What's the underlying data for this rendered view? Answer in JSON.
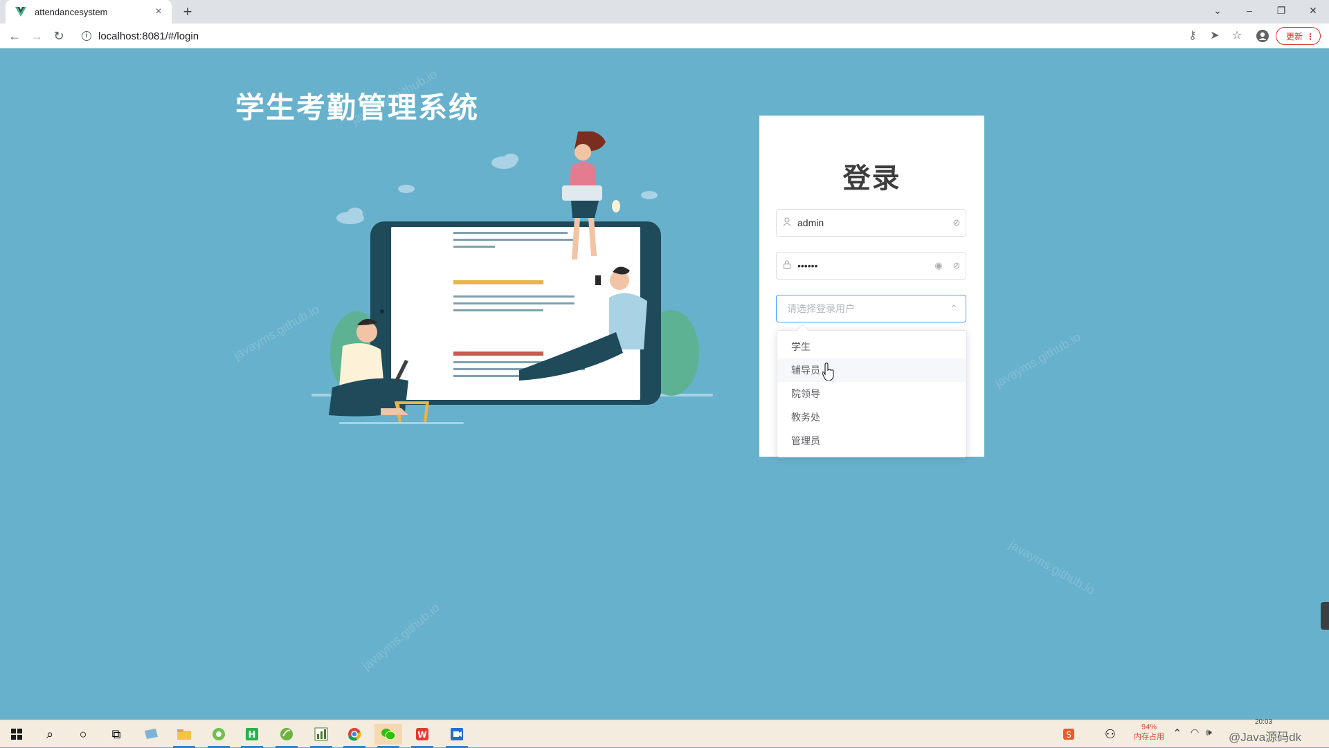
{
  "browser": {
    "tab_title": "attendancesystem",
    "url": "localhost:8081/#/login",
    "update_label": "更新"
  },
  "page": {
    "title": "学生考勤管理系统"
  },
  "login": {
    "heading": "登录",
    "username_value": "admin",
    "password_value": "••••••",
    "role_placeholder": "请选择登录用户",
    "role_options": [
      "学生",
      "辅导员",
      "院领导",
      "教务处",
      "管理员"
    ],
    "hovered_option": "辅导员"
  },
  "watermark": {
    "text": "javayms.github.io"
  },
  "taskbar": {
    "memory_percent": "94%",
    "memory_label": "内存占用",
    "clock": "20:03",
    "corner_text": "@Java源码dk"
  },
  "colors": {
    "background": "#68b1cc",
    "focus_border": "#409eff",
    "update_red": "#d93025"
  }
}
